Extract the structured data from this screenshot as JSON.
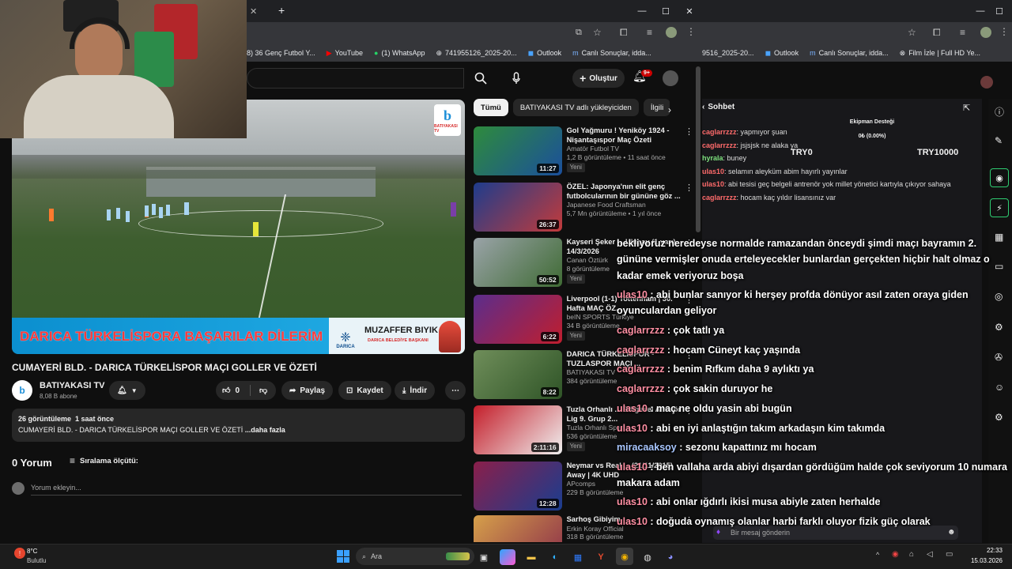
{
  "browser": {
    "new_tab": "+",
    "bookmarks": [
      "8) 36 Genç Futbol Y...",
      "YouTube",
      "(1) WhatsApp",
      "741955126_2025-20...",
      "Outlook",
      "Canlı Sonuçlar, idda..."
    ],
    "right_bookmarks": [
      "9516_2025-20...",
      "Outlook",
      "Canlı Sonuçlar, idda...",
      "Film İzle | Full HD Ye..."
    ]
  },
  "yt_header": {
    "create_label": "Oluştur",
    "notif_count": "9+"
  },
  "video": {
    "banner_text": "DARICA TÜRKELİSPORA BAŞARILAR DİLERİM",
    "banner_name": "MUZAFFER BIYIK",
    "banner_sub": "DARICA BELEDİYE BAŞKANI",
    "banner_badge": "DARICA",
    "channel_logo": "BATIYAKASI TV"
  },
  "meta": {
    "title": "CUMAYERİ BLD. - DARICA TÜRKELİSPOR MAÇI GOLLER VE ÖZETİ",
    "channel": "BATIYAKASI TV",
    "subs": "8,08 B abone",
    "likes": "0",
    "share": "Paylaş",
    "save": "Kaydet",
    "download": "İndir",
    "views": "26 görüntüleme",
    "age": "1 saat önce",
    "desc": "CUMAYERİ BLD. - DARICA TÜRKELİSPOR MAÇI GOLLER VE ÖZETİ",
    "more": "...daha fazla",
    "comments": "0 Yorum",
    "sort": "Sıralama ölçütü:",
    "add_comment": "Yorum ekleyin..."
  },
  "chips": [
    "Tümü",
    "BATIYAKASI TV adlı yükleyiciden",
    "İlgili"
  ],
  "sidebar": [
    {
      "title": "Gol Yağmuru ! Yeniköy 1924 - Nişantaşıspor Maç Özeti",
      "channel": "Amatör Futbol TV",
      "stats": "1,2 B görüntüleme • 11 saat önce",
      "dur": "11:27",
      "new": "Yeni",
      "c1": "#2e8b3c",
      "c2": "#1b4f9c"
    },
    {
      "title": "ÖZEL: Japonya'nın elit genç futbolcularının bir gününe göz ...",
      "channel": "Japanese Food Craftsman",
      "stats": "5,7 Mn görüntüleme • 1 yıl önce",
      "dur": "26:37",
      "new": "",
      "c1": "#1e3c8c",
      "c2": "#c23b3b"
    },
    {
      "title": "Kayseri Şeker ... Uluçay (1.yarı) 14/3/2026",
      "channel": "Canan Öztürk",
      "stats": "8 görüntüleme",
      "dur": "50:52",
      "new": "Yeni",
      "c1": "#9aa3a8",
      "c2": "#3f6b34"
    },
    {
      "title": "Liverpool (1-1) Tottenham | 30. Hafta MAÇ ÖZ...",
      "channel": "beIN SPORTS Türkiye",
      "stats": "34 B görüntüleme",
      "dur": "6:22",
      "new": "Yeni",
      "c1": "#5b2d8c",
      "c2": "#c01e2e"
    },
    {
      "title": "DARICA TÜRKELİSPOR - TUZLASPOR MAÇI ...",
      "channel": "BATIYAKASI TV",
      "stats": "384 görüntüleme",
      "dur": "8:22",
      "new": "",
      "c1": "#6f8e5a",
      "c2": "#2f5427"
    },
    {
      "title": "Tuzla Orhanlı ... Bölgesel Amatör Lig 9. Grup 2...",
      "channel": "Tuzla Orhanlı Spor",
      "stats": "536 görüntüleme",
      "dur": "2:11:16",
      "new": "Yeni",
      "c1": "#c41e2a",
      "c2": "#f0f0f0"
    },
    {
      "title": "Neymar vs Real ... (21/11/2015) Away | 4K UHD",
      "channel": "APcomps",
      "stats": "229 B görüntüleme",
      "dur": "12:28",
      "new": "",
      "c1": "#8a1f4a",
      "c2": "#1a3d8f"
    },
    {
      "title": "Sarhoş Gibiyim",
      "channel": "Erkin Koray Official",
      "stats": "318 B görüntüleme",
      "dur": "",
      "new": "",
      "c1": "#d6a04a",
      "c2": "#8c2f4a"
    }
  ],
  "chat_panel": {
    "title": "Sohbet",
    "stat_title": "Ekipman Desteği",
    "stat_value": "0₺ (0.00%)",
    "stat_left": "TRY0",
    "stat_right": "TRY10000",
    "lines": [
      {
        "user": "caglarrzzz",
        "msg": "yapmıyor şuan"
      },
      {
        "user": "caglarrzzz",
        "msg": "jsjsjsk ne alaka ya"
      },
      {
        "user": "hyrala",
        "msg": "buney"
      },
      {
        "user": "ulas10",
        "msg": "selamın aleyküm abim hayırlı yayınlar"
      },
      {
        "user": "ulas10",
        "msg": "abi tesisi geç belgeli antrenör yok millet yönetici kartıyla çıkıyor sahaya"
      },
      {
        "user": "caglarrzzz",
        "msg": "hocam kaç yıldır lisansınız var"
      }
    ],
    "input_placeholder": "Bir mesaj gönderin"
  },
  "overlay": [
    {
      "user": "",
      "msg": "bekliyoruz neredeyse normalde ramazandan önceydi şimdi maçı bayramın 2."
    },
    {
      "user": "",
      "msg": "gününe vermişler onuda erteleyecekler bunlardan gerçekten hiçbir halt olmaz o"
    },
    {
      "user": "",
      "msg": "kadar emek veriyoruz boşa"
    },
    {
      "user": "ulas10",
      "msg": " : abi bunlar sanıyor ki herşey profda dönüyor asıl zaten oraya giden"
    },
    {
      "user": "",
      "msg": "oyunculardan geliyor"
    },
    {
      "user": "caglarrzzz",
      "msg": " : çok tatlı ya"
    },
    {
      "user": "caglarrzzz",
      "msg": " : hocam Cüneyt kaç yaşında"
    },
    {
      "user": "caglarrzzz",
      "msg": " : benim Rıfkım daha 9 aylıktı ya"
    },
    {
      "user": "caglarrzzz",
      "msg": " : çok sakin duruyor he"
    },
    {
      "user": "ulas10",
      "msg": " : maç ne oldu yasin abi bugün"
    },
    {
      "user": "ulas10",
      "msg": " : abi en iyi anlaştığın takım arkadaşın kim takımda"
    },
    {
      "user": "miracaaksoy",
      "msg": " : sezonu kapattınız mı hocam"
    },
    {
      "user": "ulas10",
      "msg": " : ben vallaha arda abiyi dışardan gördüğüm halde çok seviyorum 10 numara"
    },
    {
      "user": "",
      "msg": "makara adam"
    },
    {
      "user": "ulas10",
      "msg": " : abi onlar ığdırlı ikisi musa abiyle zaten herhalde"
    },
    {
      "user": "ulas10",
      "msg": " : doğuda oynamış olanlar harbi farklı oluyor fizik güç olarak"
    }
  ],
  "taskbar": {
    "weather_temp": "8°C",
    "weather_desc": "Bulutlu",
    "search": "Ara",
    "time": "22:33",
    "date": "15.03.2026"
  }
}
